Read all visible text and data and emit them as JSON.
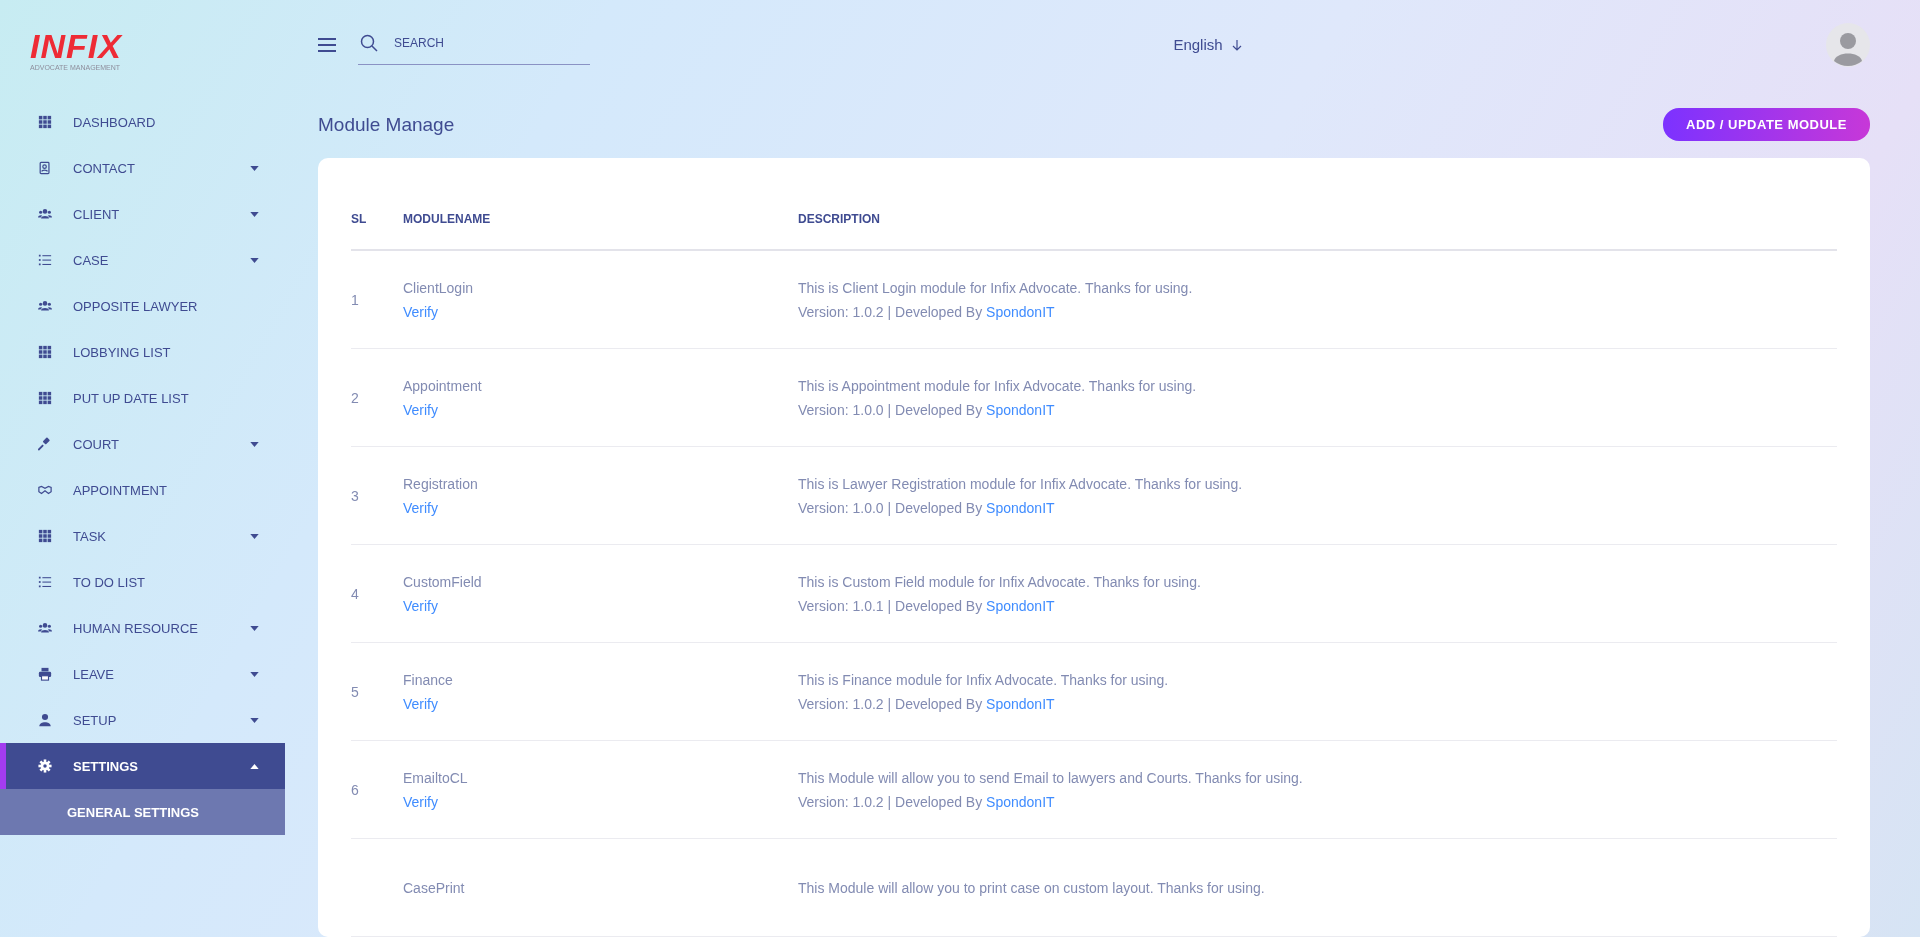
{
  "logo": {
    "name": "INFIX",
    "tagline": "ADVOCATE MANAGEMENT"
  },
  "sidebar": {
    "items": [
      {
        "kind": "grid",
        "label": "DASHBOARD",
        "selected": false
      },
      {
        "kind": "contact",
        "label": "CONTACT",
        "expanded": false,
        "selected": false
      },
      {
        "kind": "users",
        "label": "CLIENT",
        "expanded": false,
        "selected": false
      },
      {
        "kind": "list",
        "label": "CASE",
        "expanded": false,
        "selected": false
      },
      {
        "kind": "users",
        "label": "OPPOSITE LAWYER",
        "selected": false
      },
      {
        "kind": "grid",
        "label": "LOBBYING LIST",
        "selected": false
      },
      {
        "kind": "grid",
        "label": "PUT UP DATE LIST",
        "selected": false
      },
      {
        "kind": "gavel",
        "label": "COURT",
        "expanded": false,
        "selected": false
      },
      {
        "kind": "handshake",
        "label": "APPOINTMENT",
        "selected": false
      },
      {
        "kind": "grid",
        "label": "TASK",
        "expanded": false,
        "selected": false
      },
      {
        "kind": "list",
        "label": "TO DO LIST",
        "selected": false
      },
      {
        "kind": "users",
        "label": "HUMAN RESOURCE",
        "expanded": false,
        "selected": false
      },
      {
        "kind": "printer",
        "label": "LEAVE",
        "expanded": false,
        "selected": false
      },
      {
        "kind": "user",
        "label": "SETUP",
        "expanded": false,
        "selected": false
      },
      {
        "kind": "gear",
        "label": "SETTINGS",
        "expanded": true,
        "selected": true,
        "children": [
          {
            "label": "GENERAL SETTINGS"
          }
        ]
      }
    ]
  },
  "header": {
    "search": {
      "placeholder": "SEARCH"
    },
    "language": "English"
  },
  "page_title": "Module Manage",
  "add_button": "ADD / UPDATE MODULE",
  "table": {
    "columns": [
      "SL",
      "MODULENAME",
      "DESCRIPTION"
    ],
    "rows": [
      {
        "sl": "1",
        "name": "ClientLogin",
        "action": "Verify",
        "description": "This is Client Login module for Infix Advocate. Thanks for using.",
        "version": "Version: 1.0.2 | Developed By",
        "developer": "SpondonIT"
      },
      {
        "sl": "2",
        "name": "Appointment",
        "action": "Verify",
        "description": "This is Appointment module for Infix Advocate. Thanks for using.",
        "version": "Version: 1.0.0 | Developed By",
        "developer": "SpondonIT"
      },
      {
        "sl": "3",
        "name": "Registration",
        "action": "Verify",
        "description": "This is Lawyer Registration module for Infix Advocate. Thanks for using.",
        "version": "Version: 1.0.0 | Developed By",
        "developer": "SpondonIT"
      },
      {
        "sl": "4",
        "name": "CustomField",
        "action": "Verify",
        "description": "This is Custom Field module for Infix Advocate. Thanks for using.",
        "version": "Version: 1.0.1 | Developed By",
        "developer": "SpondonIT"
      },
      {
        "sl": "5",
        "name": "Finance",
        "action": "Verify",
        "description": "This is Finance module for Infix Advocate. Thanks for using.",
        "version": "Version: 1.0.2 | Developed By",
        "developer": "SpondonIT"
      },
      {
        "sl": "6",
        "name": "EmailtoCL",
        "action": "Verify",
        "description": "This Module will allow you to send Email to lawyers and Courts. Thanks for using.",
        "version": "Version: 1.0.2 | Developed By",
        "developer": "SpondonIT"
      },
      {
        "name": "CasePrint",
        "description": "This Module will allow you to print case on custom layout. Thanks for using."
      }
    ]
  }
}
